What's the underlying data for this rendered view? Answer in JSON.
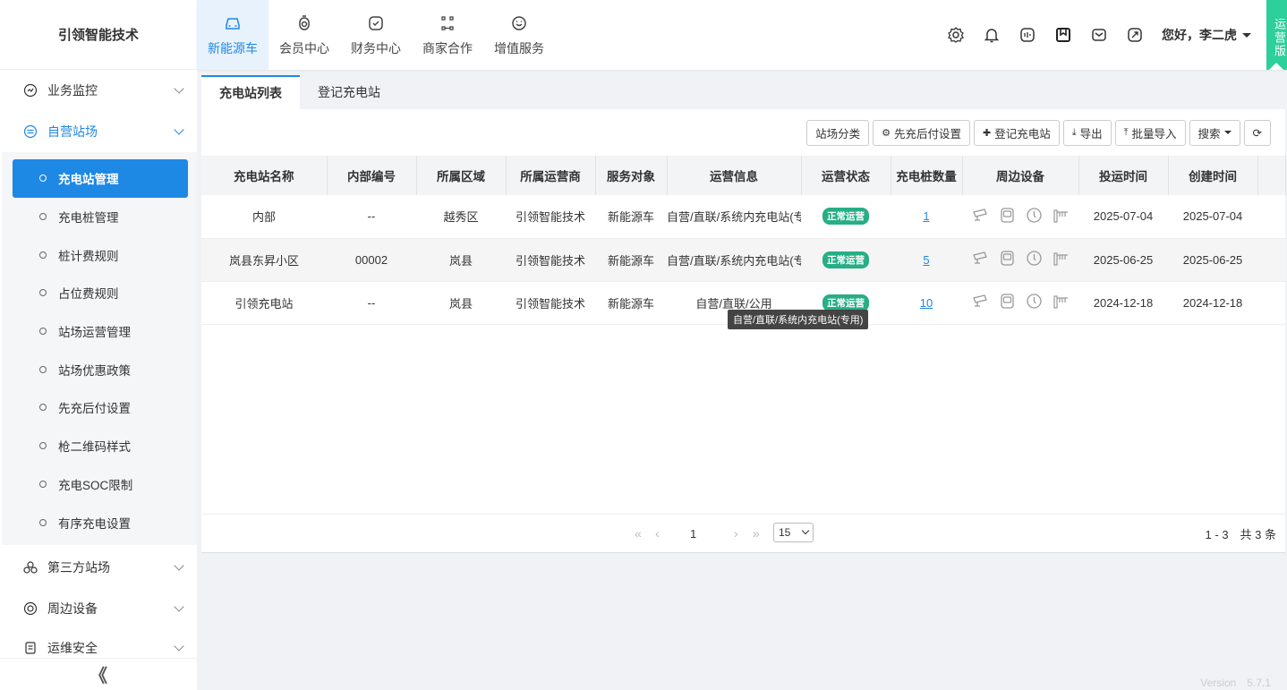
{
  "brand": "引领智能技术",
  "topnav": [
    {
      "label": "新能源车",
      "icon": "car-icon",
      "active": true
    },
    {
      "label": "会员中心",
      "icon": "member-icon",
      "active": false
    },
    {
      "label": "财务中心",
      "icon": "finance-icon",
      "active": false
    },
    {
      "label": "商家合作",
      "icon": "partner-icon",
      "active": false
    },
    {
      "label": "增值服务",
      "icon": "service-icon",
      "active": false
    }
  ],
  "header": {
    "greeting": "您好，李二虎",
    "edition": "运营版"
  },
  "sidebar": {
    "groups": [
      {
        "label": "业务监控",
        "icon": "monitor-icon"
      },
      {
        "label": "自营站场",
        "icon": "station-icon"
      },
      {
        "label": "第三方站场",
        "icon": "third-party-icon"
      },
      {
        "label": "周边设备",
        "icon": "device-icon"
      },
      {
        "label": "运维安全",
        "icon": "safety-icon"
      }
    ],
    "sub_items": [
      "充电站管理",
      "充电桩管理",
      "桩计费规则",
      "占位费规则",
      "站场运营管理",
      "站场优惠政策",
      "先充后付设置",
      "枪二维码样式",
      "充电SOC限制",
      "有序充电设置"
    ],
    "collapse": "《"
  },
  "tabs": [
    "充电站列表",
    "登记充电站"
  ],
  "toolbar": {
    "category": "站场分类",
    "prepay": "先充后付设置",
    "register": "登记充电站",
    "export": "导出",
    "import": "批量导入",
    "search": "搜索"
  },
  "table": {
    "columns": [
      "充电站名称",
      "内部编号",
      "所属区域",
      "所属运营商",
      "服务对象",
      "运营信息",
      "运营状态",
      "充电桩数量",
      "周边设备",
      "投运时间",
      "创建时间"
    ],
    "rows": [
      {
        "name": "内部",
        "code": "--",
        "region": "越秀区",
        "operator": "引领智能技术",
        "target": "新能源车",
        "info": "自营/直联/系统内充电站(专用)",
        "status": "正常运营",
        "piles": "1",
        "start": "2025-07-04",
        "created": "2025-07-04"
      },
      {
        "name": "岚县东昇小区",
        "code": "00002",
        "region": "岚县",
        "operator": "引领智能技术",
        "target": "新能源车",
        "info": "自营/直联/系统内充电站(专用)",
        "status": "正常运营",
        "piles": "5",
        "start": "2025-06-25",
        "created": "2025-06-25"
      },
      {
        "name": "引领充电站",
        "code": "--",
        "region": "岚县",
        "operator": "引领智能技术",
        "target": "新能源车",
        "info": "自营/直联/公用",
        "status": "正常运营",
        "piles": "10",
        "start": "2024-12-18",
        "created": "2024-12-18"
      }
    ]
  },
  "tooltip": "自营/直联/系统内充电站(专用)",
  "pager": {
    "page": "1",
    "size": "15",
    "info": "1 - 3　共 3 条"
  },
  "version": "Version　5.7.1",
  "colors": {
    "accent": "#1e88e5",
    "status": "#27ae85",
    "edition": "#2dcf9a"
  }
}
